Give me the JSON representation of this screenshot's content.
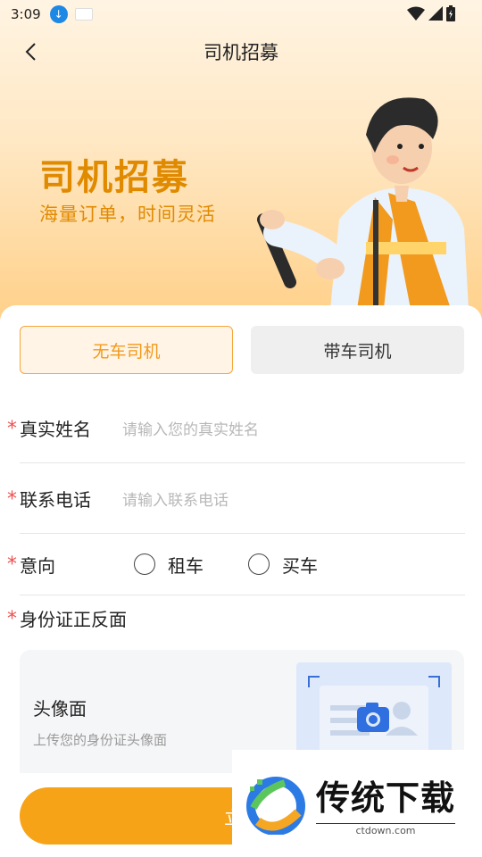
{
  "status": {
    "time": "3:09"
  },
  "header": {
    "title": "司机招募"
  },
  "hero": {
    "title": "司机招募",
    "subtitle": "海量订单，时间灵活"
  },
  "tabs": [
    {
      "label": "无车司机",
      "active": true
    },
    {
      "label": "带车司机",
      "active": false
    }
  ],
  "form": {
    "name": {
      "label": "真实姓名",
      "placeholder": "请输入您的真实姓名",
      "required_mark": "*"
    },
    "phone": {
      "label": "联系电话",
      "placeholder": "请输入联系电话",
      "required_mark": "*"
    },
    "intent": {
      "label": "意向",
      "required_mark": "*",
      "options": [
        "租车",
        "买车"
      ]
    },
    "id_card": {
      "label": "身份证正反面",
      "required_mark": "*",
      "front_title": "头像面",
      "front_sub": "上传您的身份证头像面"
    }
  },
  "submit": {
    "label": "立即"
  },
  "watermark": {
    "title": "传统下载",
    "domain": "ctdown.com"
  },
  "colors": {
    "accent": "#f7a318",
    "accent_text": "#e08a00",
    "required": "#f05050"
  },
  "icons": [
    "download-icon",
    "app-icon",
    "wifi-icon",
    "signal-icon",
    "battery-icon",
    "back-icon",
    "camera-icon"
  ]
}
